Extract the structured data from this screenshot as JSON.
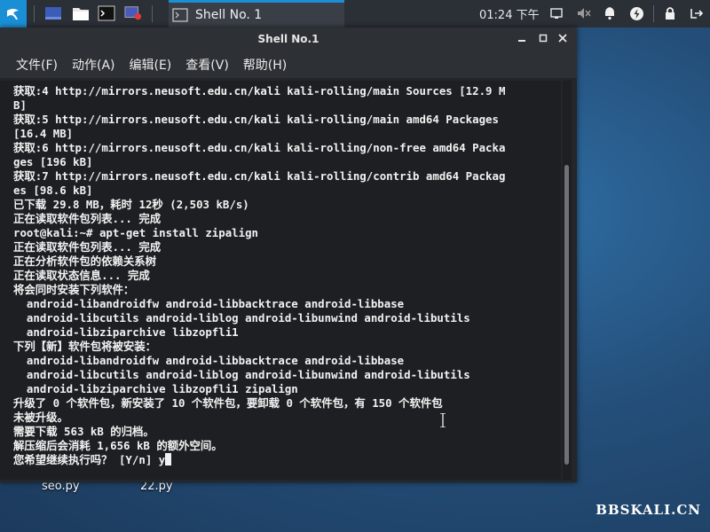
{
  "panel": {
    "task_title": "Shell No. 1",
    "clock": "01:24 下午"
  },
  "window": {
    "title": "Shell No.1",
    "menu": [
      "文件(F)",
      "动作(A)",
      "编辑(E)",
      "查看(V)",
      "帮助(H)"
    ]
  },
  "terminal": {
    "lines": [
      "获取:4 http://mirrors.neusoft.edu.cn/kali kali-rolling/main Sources [12.9 M",
      "B]",
      "获取:5 http://mirrors.neusoft.edu.cn/kali kali-rolling/main amd64 Packages",
      "[16.4 MB]",
      "获取:6 http://mirrors.neusoft.edu.cn/kali kali-rolling/non-free amd64 Packa",
      "ges [196 kB]",
      "获取:7 http://mirrors.neusoft.edu.cn/kali kali-rolling/contrib amd64 Packag",
      "es [98.6 kB]",
      "已下载 29.8 MB，耗时 12秒 (2,503 kB/s)",
      "正在读取软件包列表... 完成",
      "root@kali:~# apt-get install zipalign",
      "正在读取软件包列表... 完成",
      "正在分析软件包的依赖关系树",
      "正在读取状态信息... 完成",
      "将会同时安装下列软件：",
      "  android-libandroidfw android-libbacktrace android-libbase",
      "  android-libcutils android-liblog android-libunwind android-libutils",
      "  android-libziparchive libzopfli1",
      "下列【新】软件包将被安装：",
      "  android-libandroidfw android-libbacktrace android-libbase",
      "  android-libcutils android-liblog android-libunwind android-libutils",
      "  android-libziparchive libzopfli1 zipalign",
      "升级了 0 个软件包，新安装了 10 个软件包，要卸载 0 个软件包，有 150 个软件包",
      "未被升级。",
      "需要下载 563 kB 的归档。",
      "解压缩后会消耗 1,656 kB 的额外空间。"
    ],
    "prompt_line": "您希望继续执行吗？ [Y/n] y"
  },
  "desktop": {
    "icons": [
      "seo.py",
      "22.py"
    ],
    "watermark": "BBSKALI.CN"
  },
  "colors": {
    "accent": "#1a8fd6",
    "panel": "#2b2f36",
    "terminal_bg": "#1d1f22"
  }
}
